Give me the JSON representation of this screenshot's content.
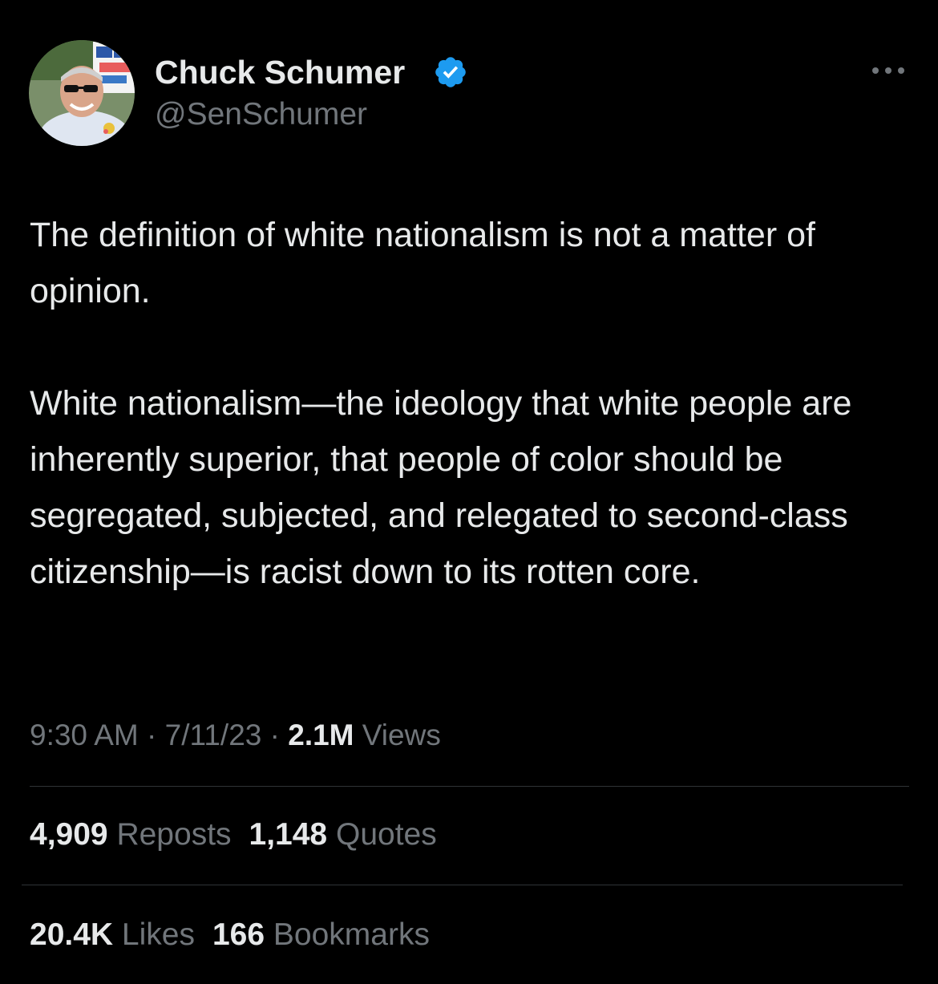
{
  "author": {
    "display_name": "Chuck Schumer",
    "handle": "@SenSchumer",
    "verified": true,
    "avatar_icon": "avatar-photo",
    "badge_color": "#1d9bf0"
  },
  "more_icon": "ellipsis-icon",
  "tweet": {
    "paragraphs": [
      "The definition of white nationalism is not a matter of opinion.",
      "White nationalism—the ideology that white people are inherently superior, that people of color should be segregated, subjected, and relegated to second-class citizenship—is racist down to its rotten core."
    ]
  },
  "meta": {
    "time": "9:30 AM",
    "separator": "·",
    "date": "7/11/23",
    "views_count": "2.1M",
    "views_label": "Views"
  },
  "stats": {
    "reposts_count": "4,909",
    "reposts_label": "Reposts",
    "quotes_count": "1,148",
    "quotes_label": "Quotes",
    "likes_count": "20.4K",
    "likes_label": "Likes",
    "bookmarks_count": "166",
    "bookmarks_label": "Bookmarks"
  },
  "colors": {
    "background": "#000000",
    "primary_text": "#e7e9ea",
    "secondary_text": "#71767b",
    "divider": "#2f3336"
  }
}
